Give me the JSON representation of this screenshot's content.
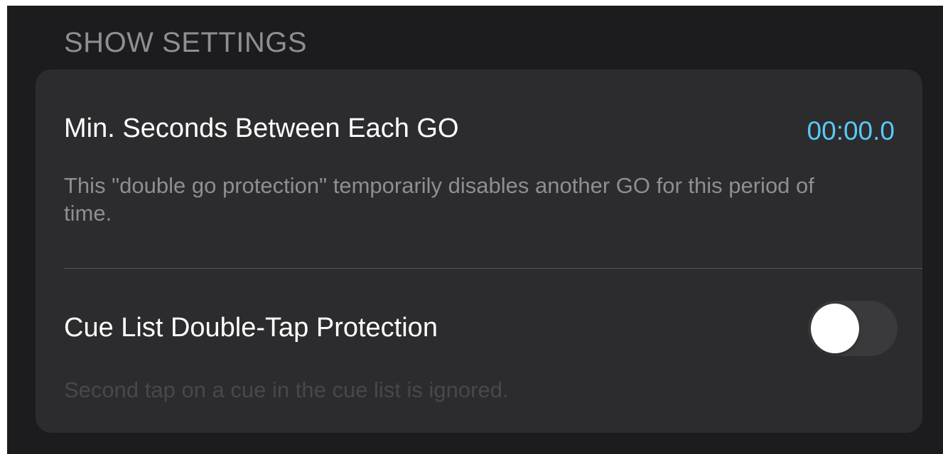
{
  "section": {
    "header": "SHOW SETTINGS"
  },
  "settings": {
    "double_go": {
      "title": "Min. Seconds Between Each GO",
      "value": "00:00.0",
      "description": "This \"double go protection\" temporarily disables another GO for this period of time."
    },
    "double_tap": {
      "title": "Cue List Double-Tap Protection",
      "toggle_on": false,
      "description": "Second tap on a cue in the cue list is ignored."
    }
  },
  "colors": {
    "background": "#1c1c1e",
    "card": "#2c2c2e",
    "accent": "#5ac8fa",
    "toggle_off": "#3a3a3c"
  }
}
